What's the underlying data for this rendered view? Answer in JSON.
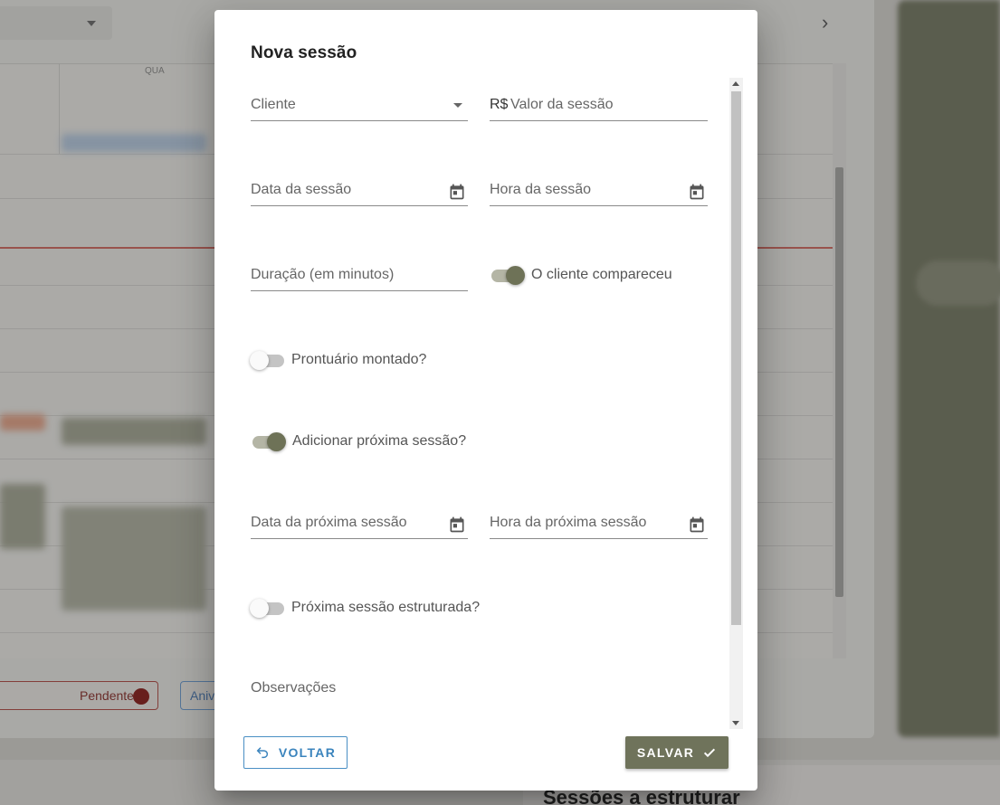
{
  "dialog": {
    "title": "Nova sessão",
    "fields": {
      "cliente": {
        "label": "Cliente"
      },
      "valor": {
        "prefix": "R$",
        "label": "Valor da sessão"
      },
      "data_sessao": {
        "label": "Data da sessão",
        "icon": "calendar-icon"
      },
      "hora_sessao": {
        "label": "Hora da sessão",
        "icon": "calendar-icon"
      },
      "duracao": {
        "label": "Duração (em minutos)"
      },
      "data_proxima": {
        "label": "Data da próxima sessão",
        "icon": "calendar-icon"
      },
      "hora_proxima": {
        "label": "Hora da próxima sessão",
        "icon": "calendar-icon"
      },
      "observacoes": {
        "label": "Observações"
      }
    },
    "switches": {
      "compareceu": {
        "label": "O cliente compareceu",
        "checked": true
      },
      "prontuario": {
        "label": "Prontuário montado?",
        "checked": false
      },
      "proxima": {
        "label": "Adicionar próxima sessão?",
        "checked": true
      },
      "estruturada": {
        "label": "Próxima sessão estruturada?",
        "checked": false
      }
    },
    "buttons": {
      "back": {
        "label": "VOLTAR",
        "icon": "undo-icon"
      },
      "save": {
        "label": "SALVAR",
        "icon": "check-icon"
      }
    }
  },
  "background": {
    "calendar_day": "QUA",
    "legend_pending": "Pendente",
    "legend_blue": "Aniv",
    "bottom_title": "Sessões a estruturar"
  },
  "colors": {
    "primary": "#6f735b",
    "link_blue": "#3b84bd",
    "now_line": "#d66a62"
  }
}
